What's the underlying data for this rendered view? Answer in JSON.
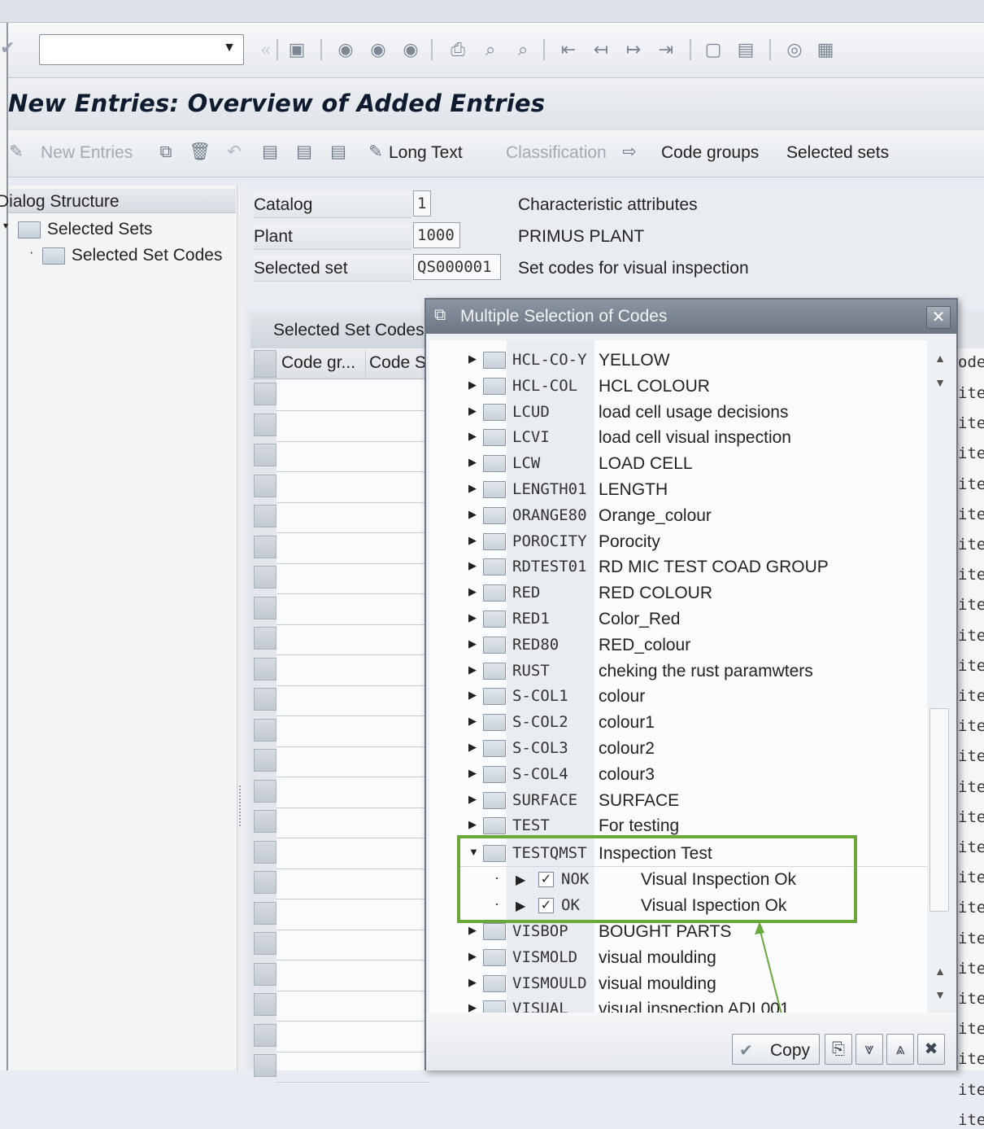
{
  "menubar": {},
  "system_toolbar": {
    "command_field_value": ""
  },
  "screen": {
    "title": "New Entries: Overview of Added Entries"
  },
  "app_toolbar": {
    "new_entries": "New Entries",
    "long_text": "Long Text",
    "classification": "Classification",
    "code_groups": "Code groups",
    "selected_sets": "Selected sets"
  },
  "dialog_structure": {
    "title": "Dialog Structure",
    "items": [
      {
        "label": "Selected Sets"
      },
      {
        "label": "Selected Set Codes"
      }
    ]
  },
  "form": {
    "catalog_label": "Catalog",
    "catalog_value": "1",
    "catalog_desc": "Characteristic attributes",
    "plant_label": "Plant",
    "plant_value": "1000",
    "plant_desc": "PRIMUS PLANT",
    "selected_set_label": "Selected set",
    "selected_set_value": "QS000001",
    "selected_set_desc": "Set codes for visual inspection"
  },
  "table": {
    "title": "Selected Set Codes",
    "columns": [
      "Code gr...",
      "Code S"
    ],
    "right_header": "ode",
    "right_cells": [
      "ite",
      "ite",
      "ite",
      "ite",
      "ite",
      "ite",
      "ite",
      "ite",
      "ite",
      "ite",
      "ite",
      "ite",
      "ite",
      "ite",
      "ite",
      "ite",
      "ite",
      "ite",
      "ite",
      "ite",
      "ite",
      "ite",
      "ite",
      "ite",
      "ite"
    ]
  },
  "dialog": {
    "title": "Multiple Selection of Codes",
    "rows": [
      {
        "code": "HCL-CO-Y",
        "desc": "YELLOW"
      },
      {
        "code": "HCL-COL",
        "desc": "HCL COLOUR"
      },
      {
        "code": "LCUD",
        "desc": "load cell usage decisions"
      },
      {
        "code": "LCVI",
        "desc": "load cell visual inspection"
      },
      {
        "code": "LCW",
        "desc": "LOAD CELL"
      },
      {
        "code": "LENGTH01",
        "desc": "LENGTH"
      },
      {
        "code": "ORANGE80",
        "desc": "Orange_colour"
      },
      {
        "code": "POROCITY",
        "desc": "Porocity"
      },
      {
        "code": "RDTEST01",
        "desc": "RD MIC TEST COAD GROUP"
      },
      {
        "code": "RED",
        "desc": "RED COLOUR"
      },
      {
        "code": "RED1",
        "desc": "Color_Red"
      },
      {
        "code": "RED80",
        "desc": "RED_colour"
      },
      {
        "code": "RUST",
        "desc": "cheking the rust paramwters"
      },
      {
        "code": "S-COL1",
        "desc": "colour"
      },
      {
        "code": "S-COL2",
        "desc": "colour1"
      },
      {
        "code": "S-COL3",
        "desc": "colour2"
      },
      {
        "code": "S-COL4",
        "desc": "colour3"
      },
      {
        "code": "SURFACE",
        "desc": "SURFACE"
      },
      {
        "code": "TEST",
        "desc": "For testing"
      }
    ],
    "expanded_group": {
      "code": "TESTQMST",
      "desc": "Inspection Test"
    },
    "children": [
      {
        "code": "NOK",
        "desc": "Visual Inspection Ok",
        "checked": true
      },
      {
        "code": "OK",
        "desc": "Visual Ispection Ok",
        "checked": true
      }
    ],
    "rows_after": [
      {
        "code": "VISBOP",
        "desc": "BOUGHT PARTS"
      },
      {
        "code": "VISMOLD",
        "desc": "visual moulding"
      },
      {
        "code": "VISMOULD",
        "desc": "visual moulding"
      },
      {
        "code": "VISUAL",
        "desc": "visual inspection ADI 001"
      }
    ],
    "copy_label": "Copy"
  },
  "colors": {
    "highlight": "#6aa83a",
    "dialog_titlebar": "#7a8591",
    "title_text": "#0e1b2e"
  }
}
